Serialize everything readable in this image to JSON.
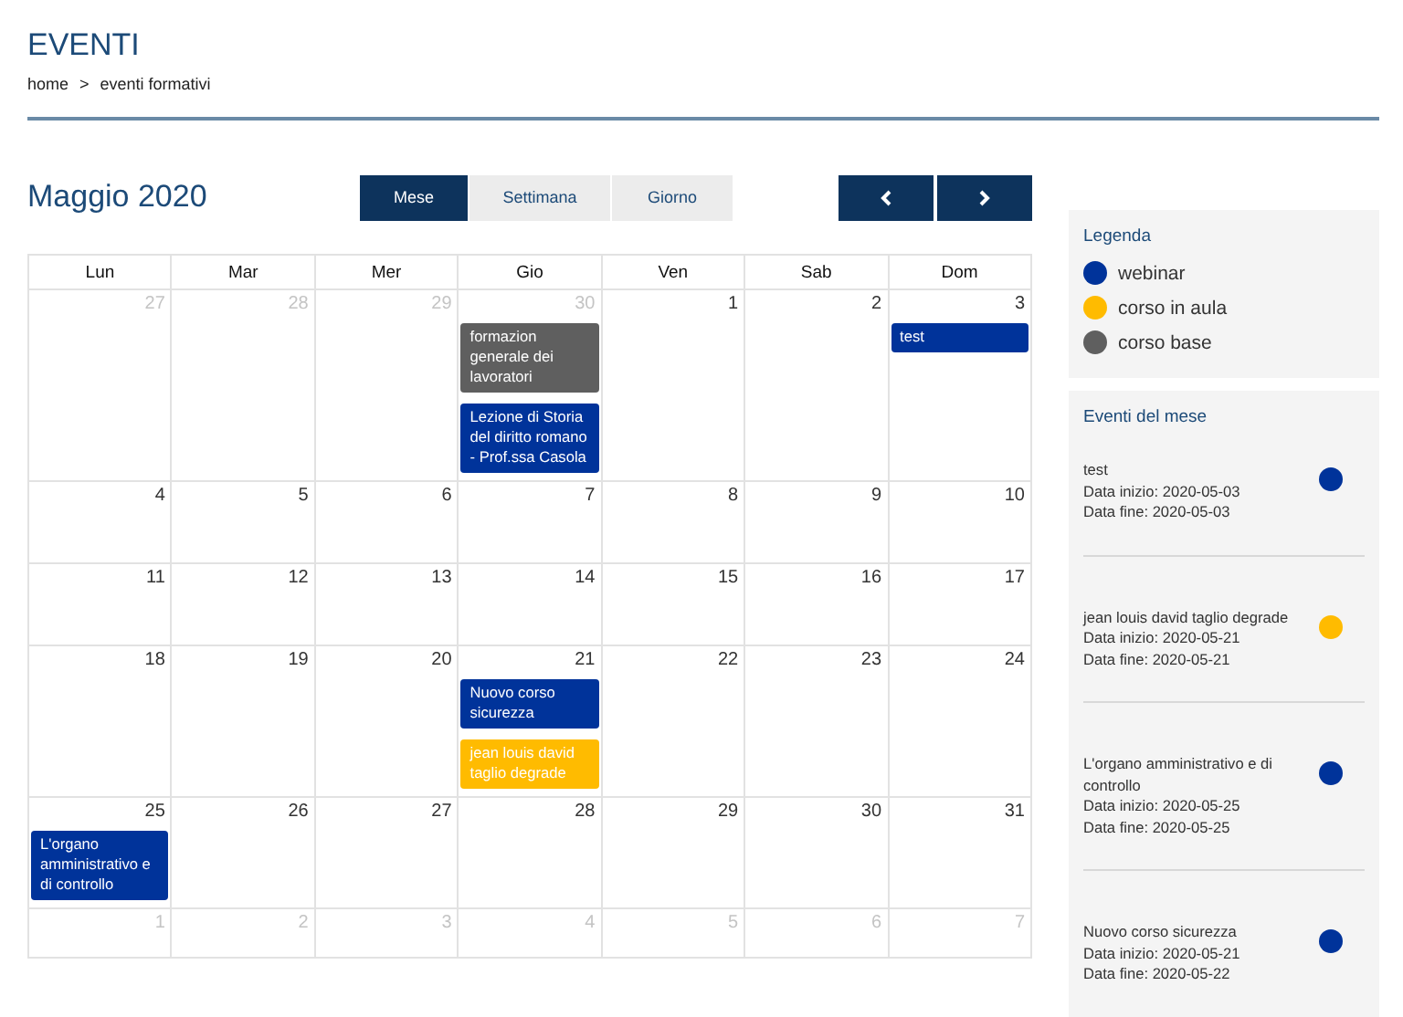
{
  "page": {
    "title": "EVENTI",
    "breadcrumb": [
      {
        "label": "home"
      },
      {
        "label": ">"
      },
      {
        "label": "eventi formativi"
      }
    ]
  },
  "calendar": {
    "title": "Maggio 2020",
    "views": [
      {
        "label": "Mese",
        "selected": true
      },
      {
        "label": "Settimana",
        "selected": false
      },
      {
        "label": "Giorno",
        "selected": false
      }
    ],
    "weekdays": [
      "Lun",
      "Mar",
      "Mer",
      "Gio",
      "Ven",
      "Sab",
      "Dom"
    ],
    "weeks": [
      {
        "days": [
          {
            "number": "27",
            "other_month": true
          },
          {
            "number": "28",
            "other_month": true
          },
          {
            "number": "29",
            "other_month": true
          },
          {
            "number": "30",
            "other_month": true,
            "events": [
              {
                "title": "formazion generale dei lavoratori",
                "color": "#5f5f5f"
              },
              {
                "title": "Lezione di Storia del diritto romano - Prof.ssa Casola",
                "color": "#00339a"
              }
            ]
          },
          {
            "number": "1",
            "other_month": false
          },
          {
            "number": "2",
            "other_month": false
          },
          {
            "number": "3",
            "other_month": false,
            "events": [
              {
                "title": "test",
                "color": "#00339a"
              }
            ]
          }
        ]
      },
      {
        "days": [
          {
            "number": "4",
            "other_month": false
          },
          {
            "number": "5",
            "other_month": false
          },
          {
            "number": "6",
            "other_month": false
          },
          {
            "number": "7",
            "other_month": false
          },
          {
            "number": "8",
            "other_month": false
          },
          {
            "number": "9",
            "other_month": false
          },
          {
            "number": "10",
            "other_month": false
          }
        ]
      },
      {
        "days": [
          {
            "number": "11",
            "other_month": false
          },
          {
            "number": "12",
            "other_month": false
          },
          {
            "number": "13",
            "other_month": false
          },
          {
            "number": "14",
            "other_month": false
          },
          {
            "number": "15",
            "other_month": false
          },
          {
            "number": "16",
            "other_month": false
          },
          {
            "number": "17",
            "other_month": false
          }
        ]
      },
      {
        "days": [
          {
            "number": "18",
            "other_month": false
          },
          {
            "number": "19",
            "other_month": false
          },
          {
            "number": "20",
            "other_month": false
          },
          {
            "number": "21",
            "other_month": false,
            "events": [
              {
                "title": "Nuovo corso sicurezza",
                "color": "#00339a"
              },
              {
                "title": "jean louis david taglio degrade",
                "color": "#ffbb00"
              }
            ]
          },
          {
            "number": "22",
            "other_month": false
          },
          {
            "number": "23",
            "other_month": false
          },
          {
            "number": "24",
            "other_month": false
          }
        ]
      },
      {
        "days": [
          {
            "number": "25",
            "other_month": false,
            "events": [
              {
                "title": "L'organo amministrativo e di controllo",
                "color": "#00339a"
              }
            ]
          },
          {
            "number": "26",
            "other_month": false
          },
          {
            "number": "27",
            "other_month": false
          },
          {
            "number": "28",
            "other_month": false
          },
          {
            "number": "29",
            "other_month": false
          },
          {
            "number": "30",
            "other_month": false
          },
          {
            "number": "31",
            "other_month": false
          }
        ]
      },
      {
        "days": [
          {
            "number": "1",
            "other_month": true
          },
          {
            "number": "2",
            "other_month": true
          },
          {
            "number": "3",
            "other_month": true
          },
          {
            "number": "4",
            "other_month": true
          },
          {
            "number": "5",
            "other_month": true
          },
          {
            "number": "6",
            "other_month": true
          },
          {
            "number": "7",
            "other_month": true
          }
        ]
      }
    ]
  },
  "legend": {
    "title": "Legenda",
    "items": [
      {
        "label": "webinar",
        "color": "#00339a"
      },
      {
        "label": "corso in aula",
        "color": "#ffbb00"
      },
      {
        "label": "corso base",
        "color": "#5f5f5f"
      }
    ]
  },
  "month_events": {
    "title": "Eventi del mese",
    "items": [
      {
        "title": "test",
        "start": "Data inizio: 2020-05-03",
        "end": "Data fine: 2020-05-03",
        "color": "#00339a"
      },
      {
        "title": "jean louis david taglio degrade",
        "start": "Data inizio: 2020-05-21",
        "end": "Data fine: 2020-05-21",
        "color": "#ffbb00"
      },
      {
        "title": "L'organo amministrativo e di controllo",
        "start": "Data inizio: 2020-05-25",
        "end": "Data fine: 2020-05-25",
        "color": "#00339a"
      },
      {
        "title": "Nuovo corso sicurezza",
        "start": "Data inizio: 2020-05-21",
        "end": "Data fine: 2020-05-22",
        "color": "#00339a"
      }
    ]
  }
}
